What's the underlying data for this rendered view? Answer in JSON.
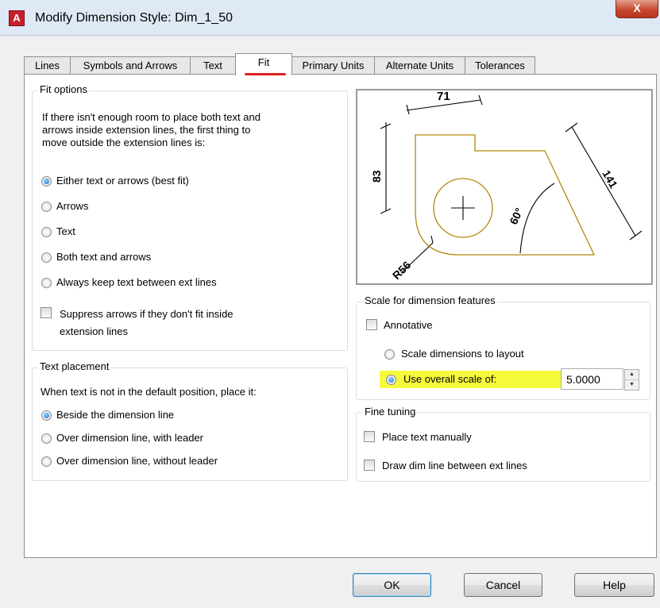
{
  "window": {
    "title": "Modify Dimension Style: Dim_1_50",
    "close_glyph": "X",
    "app_icon_letter": "A"
  },
  "tabs": [
    {
      "label": "Lines"
    },
    {
      "label": "Symbols and Arrows"
    },
    {
      "label": "Text"
    },
    {
      "label": "Fit"
    },
    {
      "label": "Primary Units"
    },
    {
      "label": "Alternate Units"
    },
    {
      "label": "Tolerances"
    }
  ],
  "active_tab": "Fit",
  "fit_options": {
    "title": "Fit options",
    "description_lines": [
      "If there isn't enough room to place both text and",
      "arrows inside extension lines, the first thing to",
      "move outside the extension lines is:"
    ],
    "options": [
      {
        "label": "Either text or arrows (best fit)",
        "selected": true
      },
      {
        "label": "Arrows",
        "selected": false
      },
      {
        "label": "Text",
        "selected": false
      },
      {
        "label": "Both text and arrows",
        "selected": false
      },
      {
        "label": "Always keep text between ext lines",
        "selected": false
      }
    ],
    "suppress_label_lines": [
      "Suppress arrows if they don't fit inside",
      "extension lines"
    ],
    "suppress_checked": false
  },
  "text_placement": {
    "title": "Text placement",
    "description": "When text is not in the default position, place it:",
    "options": [
      {
        "label": "Beside the dimension line",
        "selected": true
      },
      {
        "label": "Over dimension line, with leader",
        "selected": false
      },
      {
        "label": "Over dimension line, without leader",
        "selected": false
      }
    ]
  },
  "preview": {
    "labels": {
      "top": "71",
      "left": "83",
      "right": "141",
      "angle": "60°",
      "radius": "R56"
    },
    "shape_color": "#b8860b"
  },
  "scale": {
    "title": "Scale for dimension features",
    "annotative_label": "Annotative",
    "annotative_checked": false,
    "layout_label": "Scale dimensions to layout",
    "overall_label": "Use overall scale of:",
    "overall_selected": true,
    "overall_value": "5.0000",
    "highlight_color": "#f6fa3c"
  },
  "fine_tuning": {
    "title": "Fine tuning",
    "place_text_label": "Place text manually",
    "place_text_checked": false,
    "draw_dim_label": "Draw dim line between ext lines",
    "draw_dim_checked": false
  },
  "buttons": {
    "ok": "OK",
    "cancel": "Cancel",
    "help": "Help"
  }
}
